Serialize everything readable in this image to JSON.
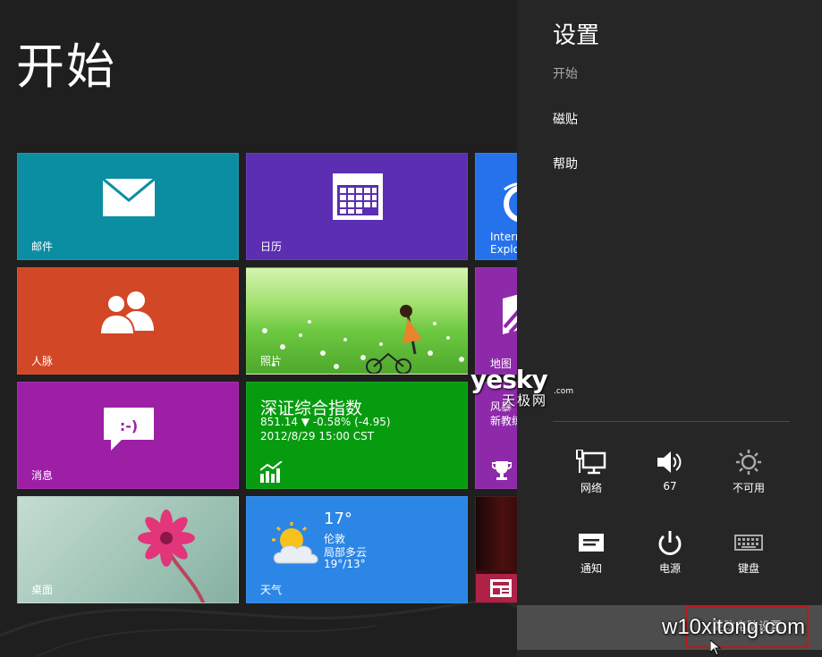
{
  "start": {
    "title": "开始",
    "tiles": {
      "mail": "邮件",
      "calendar": "日历",
      "ie": "Intern\nExplo",
      "people": "人脉",
      "photo": "照片",
      "maps": "地图",
      "messaging": "消息",
      "finance": {
        "title": "深证综合指数",
        "line1": "851.14  ▼ -0.58% (-4.95)",
        "line2": "2012/8/29 15:00 CST"
      },
      "news": {
        "line1": "风暴",
        "line2": "新教练"
      },
      "desktop": "桌面",
      "weather": {
        "label": "天气",
        "temp": "17°",
        "city": "伦敦",
        "desc": "局部多云",
        "range": "19°/13°"
      }
    }
  },
  "charm": {
    "title": "设置",
    "subtitle": "开始",
    "links": [
      "磁贴",
      "帮助"
    ],
    "quick_settings": [
      {
        "label": "网络",
        "icon": "network-icon"
      },
      {
        "label": "67",
        "icon": "volume-icon"
      },
      {
        "label": "不可用",
        "icon": "brightness-icon"
      },
      {
        "label": "通知",
        "icon": "notifications-icon"
      },
      {
        "label": "电源",
        "icon": "power-icon"
      },
      {
        "label": "键盘",
        "icon": "keyboard-icon"
      }
    ],
    "bottom_button": "更改电脑设置"
  },
  "watermarks": {
    "yesky": "yesky",
    "yesky_com": ".com",
    "yesky_cn": "天极网",
    "w10": "w10xitong.com"
  }
}
